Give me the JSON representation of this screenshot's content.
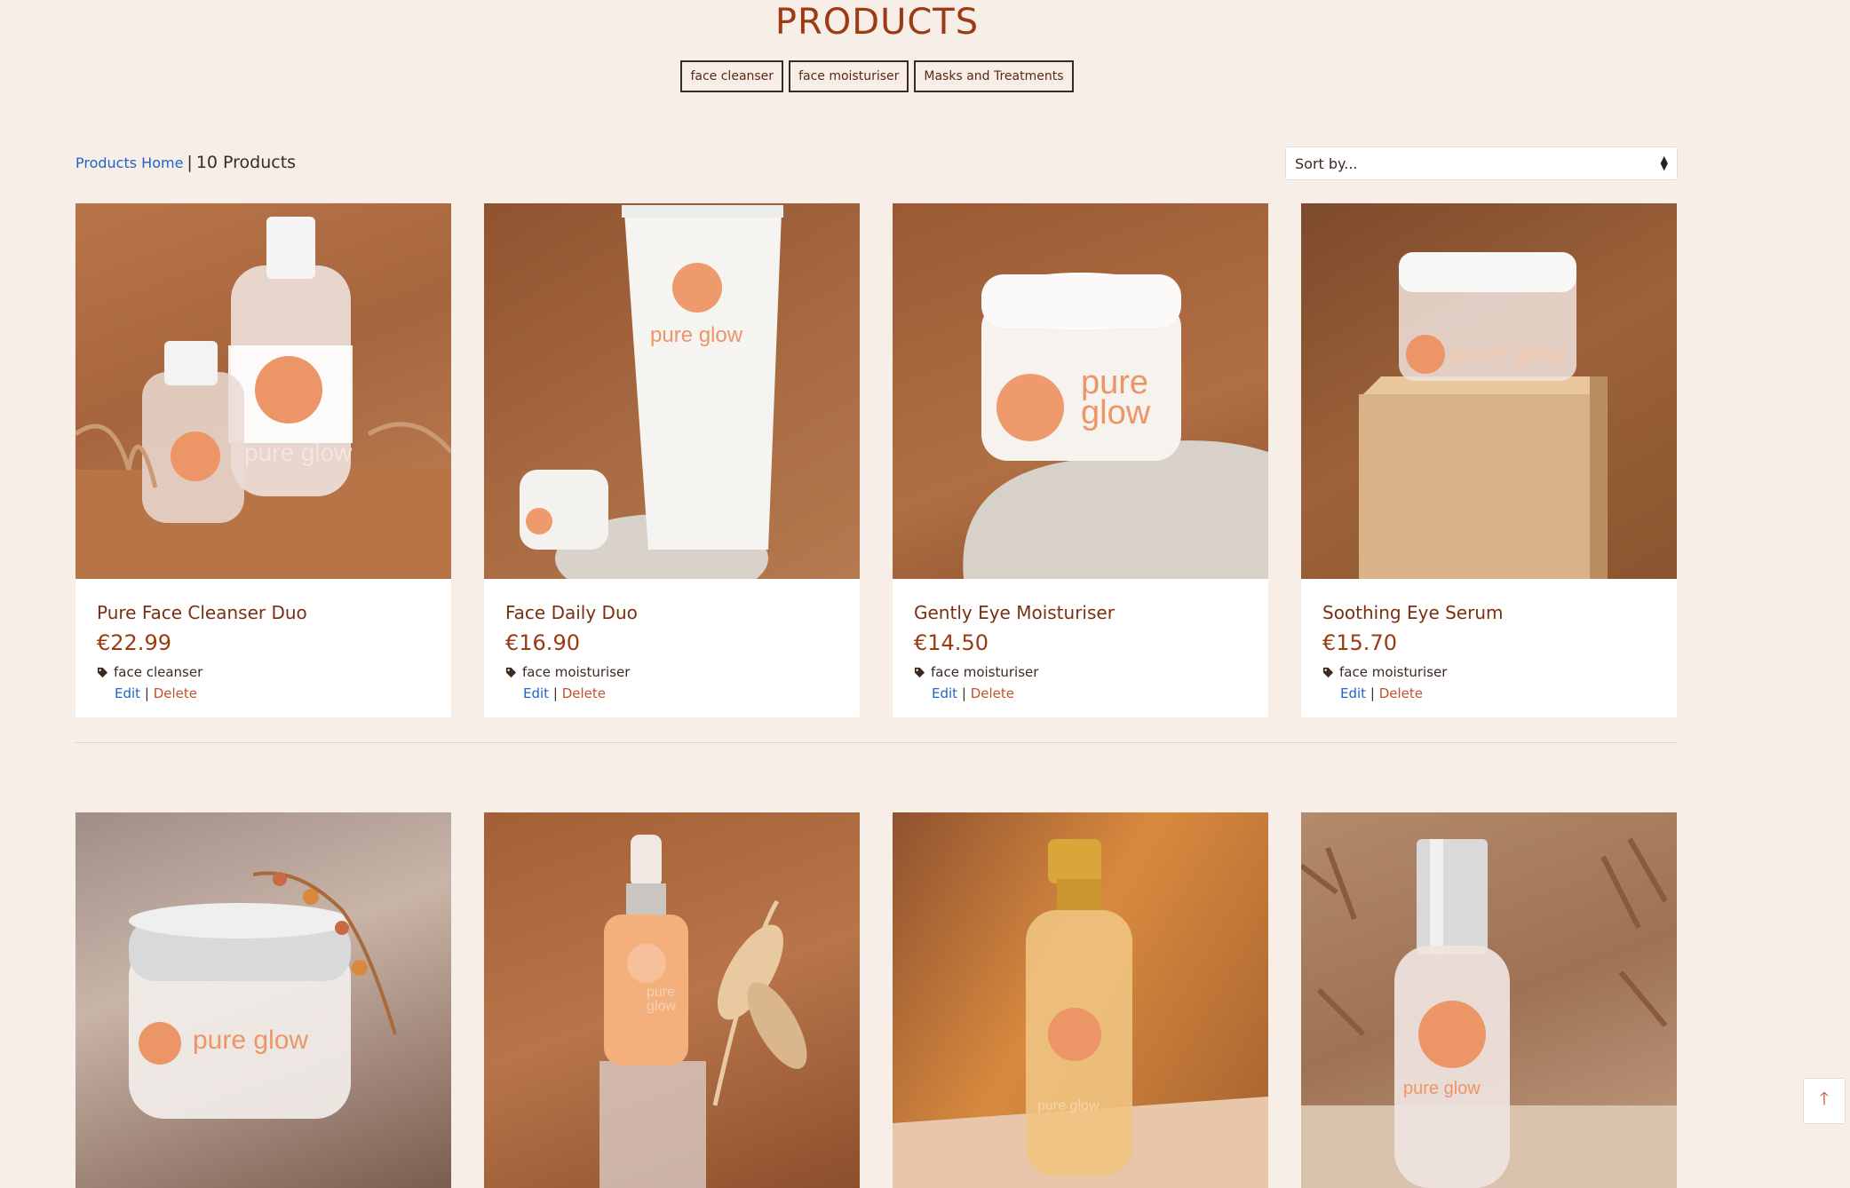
{
  "header": {
    "title": "PRODUCTS"
  },
  "categories": [
    {
      "label": "face cleanser"
    },
    {
      "label": "face moisturiser"
    },
    {
      "label": "Masks and Treatments"
    }
  ],
  "breadcrumb": {
    "home_label": "Products Home",
    "separator": "|",
    "count_label": "10 Products"
  },
  "sort": {
    "label": "Sort by..."
  },
  "actions": {
    "edit_label": "Edit",
    "separator": "|",
    "delete_label": "Delete"
  },
  "products": [
    {
      "name": "Pure Face Cleanser Duo",
      "price": "€22.99",
      "category": "face cleanser",
      "logo_text": "pure glow",
      "image_icon": "cleanser-bottles-image"
    },
    {
      "name": "Face Daily Duo",
      "price": "€16.90",
      "category": "face moisturiser",
      "logo_text": "pure glow",
      "image_icon": "tube-and-jar-image"
    },
    {
      "name": "Gently Eye Moisturiser",
      "price": "€14.50",
      "category": "face moisturiser",
      "logo_text": "pure glow",
      "image_icon": "cream-jar-image"
    },
    {
      "name": "Soothing Eye Serum",
      "price": "€15.70",
      "category": "face moisturiser",
      "logo_text": "pure glow",
      "image_icon": "jar-on-wood-image"
    },
    {
      "logo_text": "pure glow",
      "image_icon": "silver-lid-jar-image"
    },
    {
      "logo_text": "pure glow",
      "image_icon": "dropper-bottle-image"
    },
    {
      "logo_text": "pure glow",
      "image_icon": "pump-bottle-image"
    },
    {
      "logo_text": "pure glow",
      "image_icon": "spray-bottle-image"
    }
  ],
  "colors": {
    "background": "#f8eee8",
    "accent": "#9a3b12",
    "link": "#1f63c8",
    "delete": "#c0522a"
  },
  "back_to_top_icon": "arrow-up-icon"
}
